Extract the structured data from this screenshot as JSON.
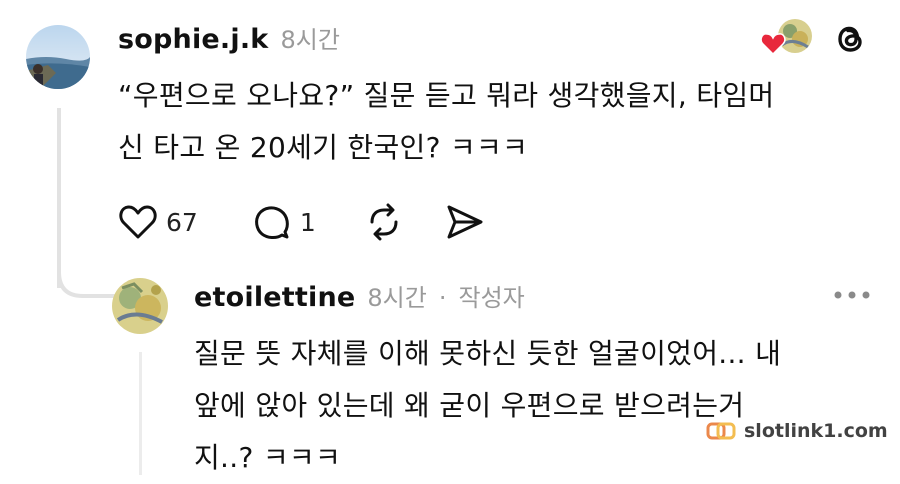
{
  "post": {
    "username": "sophie.j.k",
    "time": "8시간",
    "text_line1": "“우편으로 오나요?” 질문 듣고 뭐라 생각했을지, 타임머",
    "text_line2": "신 타고 온 20세기 한국인? ㅋㅋㅋ",
    "like_count": "67",
    "reply_count": "1",
    "icons": [
      "heart-icon",
      "comment-icon",
      "repost-icon",
      "share-icon",
      "threads-logo-icon"
    ]
  },
  "reply": {
    "username": "etoilettine",
    "time": "8시간",
    "separator": "·",
    "author_badge": "작성자",
    "text_line1": "질문 뜻 자체를 이해 못하신 듯한 얼굴이었어... 내",
    "text_line2": "앞에 앉아 있는데 왜 굳이 우편으로 받으려는거",
    "text_line3": "지..? ㅋㅋㅋ",
    "icons": [
      "more-options-icon"
    ]
  },
  "watermark": {
    "text": "slotlink1.com"
  },
  "colors": {
    "text": "#111111",
    "meta": "#9a9a9a",
    "heart": "#e8283c",
    "thread_line": "#e2e2e2"
  }
}
